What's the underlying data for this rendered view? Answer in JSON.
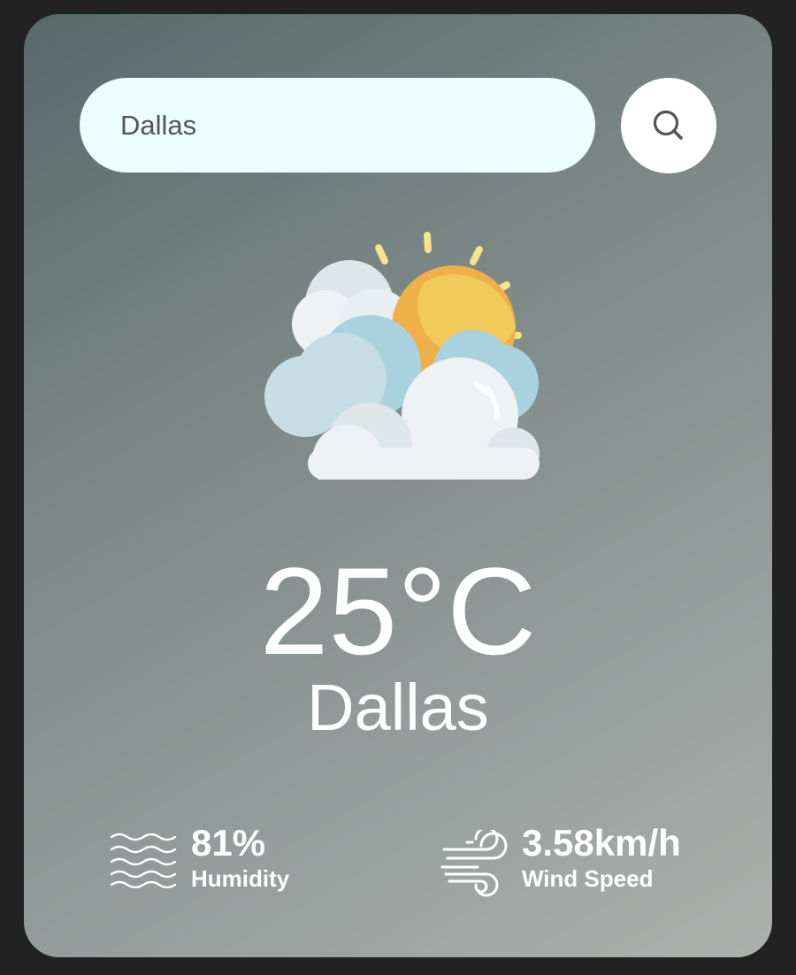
{
  "search": {
    "value": "Dallas",
    "icon": "search-icon"
  },
  "weather": {
    "icon": "partly-cloudy-icon",
    "temperature": "25°C",
    "city": "Dallas"
  },
  "humidity": {
    "value": "81%",
    "label": "Humidity",
    "icon": "humidity-waves-icon"
  },
  "wind": {
    "value": "3.58km/h",
    "label": "Wind Speed",
    "icon": "wind-icon"
  },
  "colors": {
    "background": "#222222",
    "card_gradient_start": "#566a69",
    "card_gradient_end": "#adb0ad",
    "search_field": "#ebfdfd",
    "text": "#ffffff"
  }
}
